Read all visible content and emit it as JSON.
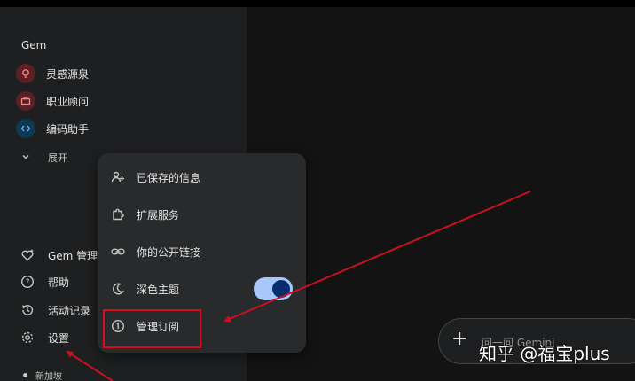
{
  "sidebar": {
    "gem_header": "Gem",
    "gems": [
      {
        "label": "灵感源泉",
        "icon": "lightbulb-icon",
        "bg": "#5c1f23",
        "fg": "#f28b82"
      },
      {
        "label": "职业顾问",
        "icon": "briefcase-icon",
        "bg": "#5c1f23",
        "fg": "#f28b82"
      },
      {
        "label": "编码助手",
        "icon": "code-icon",
        "bg": "#0b3a52",
        "fg": "#7cacf8"
      }
    ],
    "expand_label": "展开",
    "bottom_items": [
      {
        "label": "Gem 管理器",
        "icon": "gem-heart-icon"
      },
      {
        "label": "帮助",
        "icon": "help-icon"
      },
      {
        "label": "活动记录",
        "icon": "history-icon"
      },
      {
        "label": "设置",
        "icon": "gear-icon"
      }
    ],
    "location": "新加坡"
  },
  "settings_menu": {
    "items": [
      {
        "label": "已保存的信息",
        "icon": "person-add-icon"
      },
      {
        "label": "扩展服务",
        "icon": "puzzle-icon"
      },
      {
        "label": "你的公开链接",
        "icon": "link-icon"
      },
      {
        "label": "深色主题",
        "icon": "moon-icon"
      },
      {
        "label": "管理订阅",
        "icon": "subscription-icon"
      }
    ],
    "dark_theme_enabled": true
  },
  "prompt": {
    "placeholder": "问一问 Gemini"
  },
  "watermark": "知乎 @福宝plus",
  "colors": {
    "annotation_red": "#c8101e",
    "toggle_track": "#a8c7fa",
    "toggle_knob": "#062e6f"
  }
}
